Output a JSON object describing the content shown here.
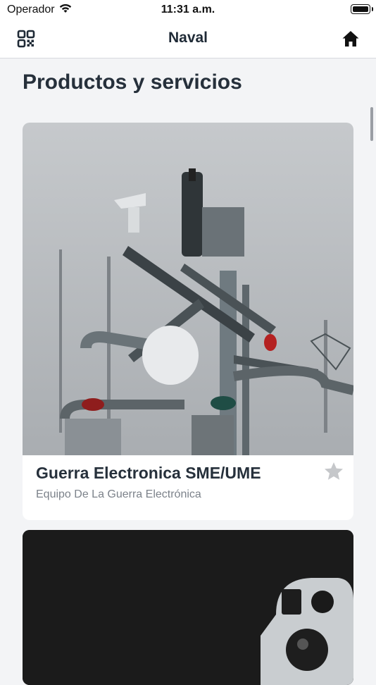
{
  "status_bar": {
    "carrier": "Operador",
    "time": "11:31 a.m."
  },
  "nav": {
    "title": "Naval",
    "left_icon": "qr-code-icon",
    "right_icon": "home-icon"
  },
  "section": {
    "title": "Productos y servicios"
  },
  "products": [
    {
      "title": "Guerra Electronica SME/UME",
      "subtitle": "Equipo De La Guerra Electrónica",
      "favorite": false,
      "favorite_icon": "star-icon"
    },
    {
      "title": "",
      "subtitle": ""
    }
  ],
  "colors": {
    "text": "#26303b",
    "subtitle": "#7c828a",
    "background": "#f3f4f6",
    "star": "#c5c7ca"
  }
}
